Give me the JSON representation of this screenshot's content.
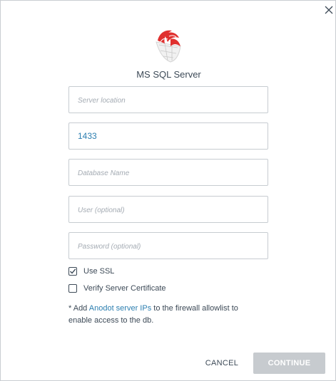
{
  "dialog": {
    "title": "MS SQL Server",
    "logo_icon": "ms-sql-server-logo",
    "close_icon": "close-icon"
  },
  "fields": {
    "server_location": {
      "placeholder": "Server location",
      "value": ""
    },
    "port": {
      "placeholder": "",
      "value": "1433"
    },
    "database_name": {
      "placeholder": "Database Name",
      "value": ""
    },
    "user": {
      "placeholder": "User (optional)",
      "value": ""
    },
    "password": {
      "placeholder": "Password (optional)",
      "value": ""
    }
  },
  "options": {
    "use_ssl": {
      "label": "Use SSL",
      "checked": true
    },
    "verify_cert": {
      "label": "Verify Server Certificate",
      "checked": false
    }
  },
  "note": {
    "prefix": "* Add ",
    "link": "Anodot server IPs",
    "suffix": " to the firewall allowlist to enable access to the db."
  },
  "actions": {
    "cancel_label": "CANCEL",
    "continue_label": "CONTINUE"
  },
  "colors": {
    "accent": "#2d7fb0",
    "disabled_button": "#c7cbcf",
    "logo_red": "#e0302f",
    "text": "#3d4a57"
  }
}
